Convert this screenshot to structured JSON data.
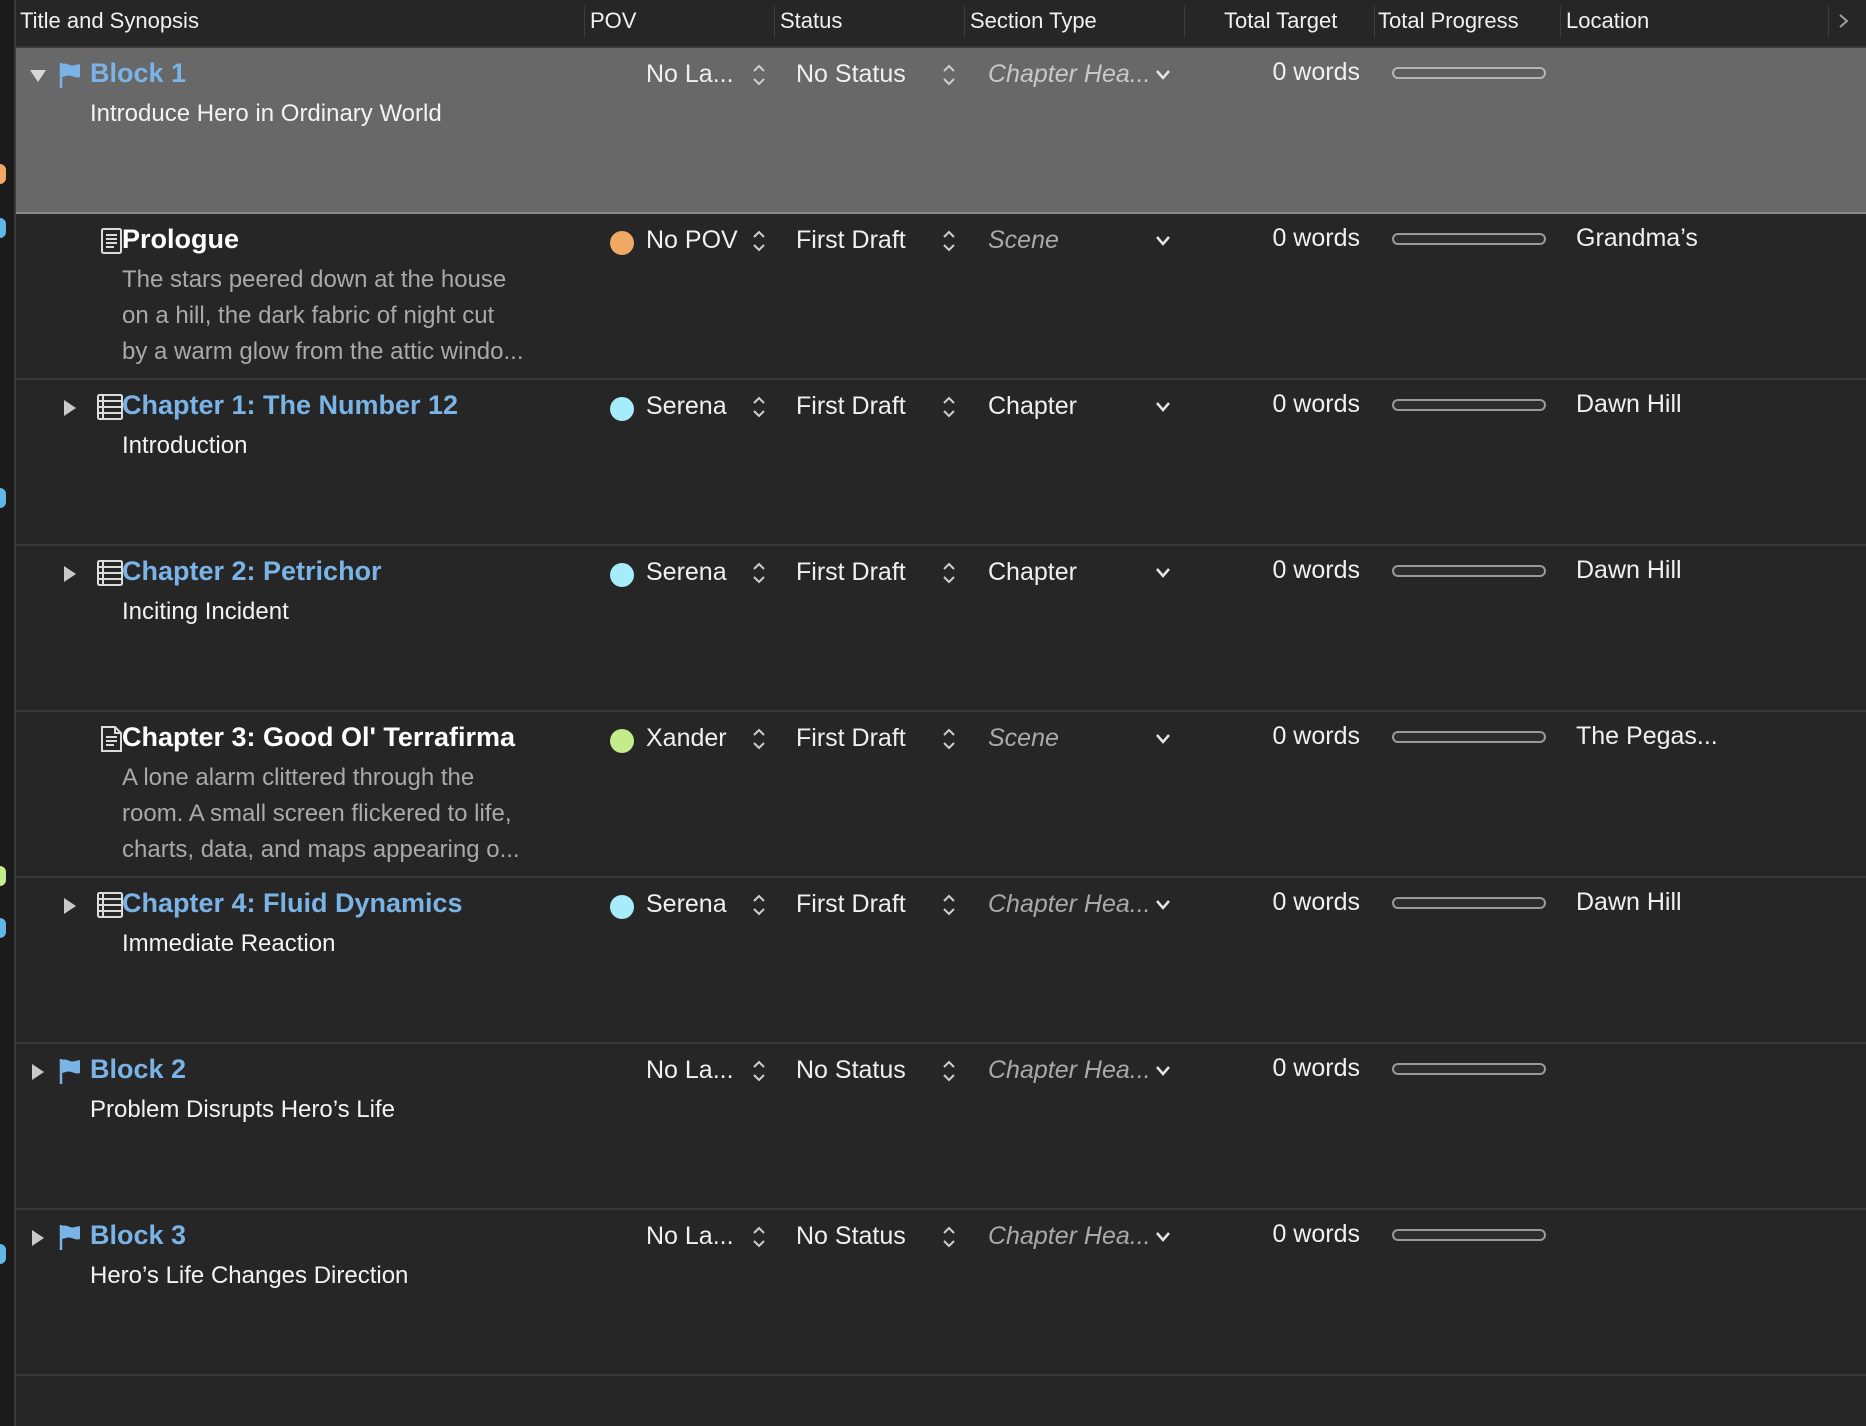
{
  "header": {
    "title_synopsis": "Title and Synopsis",
    "pov": "POV",
    "status": "Status",
    "section_type": "Section Type",
    "total_target": "Total Target",
    "total_progress": "Total Progress",
    "location": "Location"
  },
  "colors": {
    "link_blue": "#7ab3e6",
    "selected_row": "#686868",
    "background": "#262626"
  },
  "rows": [
    {
      "title": "Block 1",
      "synopsis": [
        "Introduce Hero in Ordinary World"
      ],
      "pov": "No La...",
      "status": "No Status",
      "section_type": "Chapter Hea...",
      "target": "0 words",
      "progress": 0,
      "location": ""
    },
    {
      "title": "Prologue",
      "synopsis": [
        "The stars peered down at the house",
        "on a hill, the dark fabric of night cut",
        "by a warm glow from the attic windo..."
      ],
      "pov": "No POV",
      "pov_color": "#f0a865",
      "status": "First Draft",
      "section_type": "Scene",
      "target": "0 words",
      "progress": 0,
      "location": "Grandma’s"
    },
    {
      "title": "Chapter 1: The Number 12",
      "synopsis": [
        "Introduction"
      ],
      "pov": "Serena",
      "pov_color": "#a6ecfa",
      "status": "First Draft",
      "section_type": "Chapter",
      "target": "0 words",
      "progress": 0,
      "location": "Dawn Hill"
    },
    {
      "title": "Chapter 2: Petrichor",
      "synopsis": [
        "Inciting Incident"
      ],
      "pov": "Serena",
      "pov_color": "#a6ecfa",
      "status": "First Draft",
      "section_type": "Chapter",
      "target": "0 words",
      "progress": 0,
      "location": "Dawn Hill"
    },
    {
      "title": "Chapter 3: Good Ol' Terrafirma",
      "synopsis": [
        "A lone alarm clittered through the",
        "room. A small screen flickered to life,",
        "charts, data, and maps appearing o..."
      ],
      "pov": "Xander",
      "pov_color": "#c4ec8a",
      "status": "First Draft",
      "section_type": "Scene",
      "target": "0 words",
      "progress": 0,
      "location": "The Pegas..."
    },
    {
      "title": "Chapter 4: Fluid Dynamics",
      "synopsis": [
        "Immediate Reaction"
      ],
      "pov": "Serena",
      "pov_color": "#a6ecfa",
      "status": "First Draft",
      "section_type": "Chapter Hea...",
      "target": "0 words",
      "progress": 0,
      "location": "Dawn Hill"
    },
    {
      "title": "Block 2",
      "synopsis": [
        "Problem Disrupts Hero’s Life"
      ],
      "pov": "No La...",
      "status": "No Status",
      "section_type": "Chapter Hea...",
      "target": "0 words",
      "progress": 0,
      "location": ""
    },
    {
      "title": "Block 3",
      "synopsis": [
        "Hero’s Life Changes Direction"
      ],
      "pov": "No La...",
      "status": "No Status",
      "section_type": "Chapter Hea...",
      "target": "0 words",
      "progress": 0,
      "location": ""
    }
  ]
}
